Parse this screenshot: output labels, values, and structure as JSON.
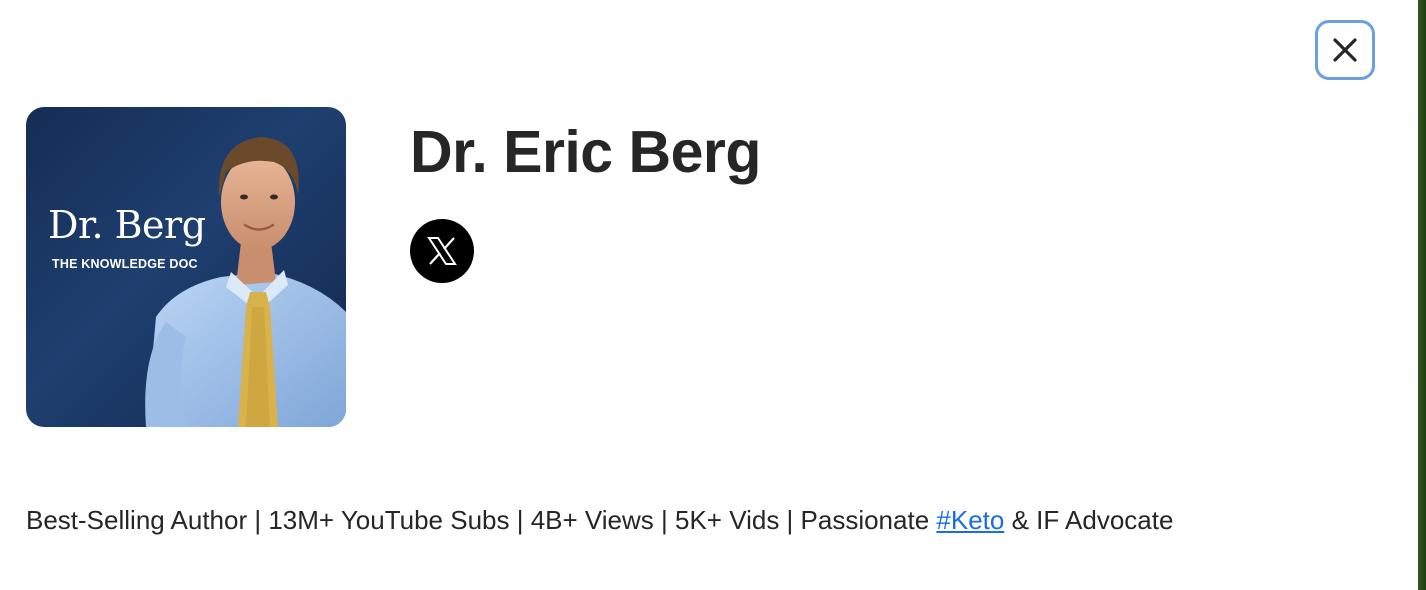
{
  "dialog": {
    "close_icon": "close-icon",
    "accent_color": "#6aa0e0"
  },
  "profile": {
    "avatar": {
      "brand_text": "Dr. Berg",
      "tagline": "THE KNOWLEDGE DOC",
      "background_color": "#1e3f70"
    },
    "name": "Dr. Eric Berg",
    "social": {
      "icon": "x-logo-icon"
    },
    "bio": {
      "before_link": "Best-Selling Author | 13M+ YouTube Subs | 4B+ Views | 5K+ Vids | Passionate ",
      "hashtag": "#Keto",
      "after_link": " & IF Advocate",
      "link_color": "#1b6ee0"
    }
  }
}
